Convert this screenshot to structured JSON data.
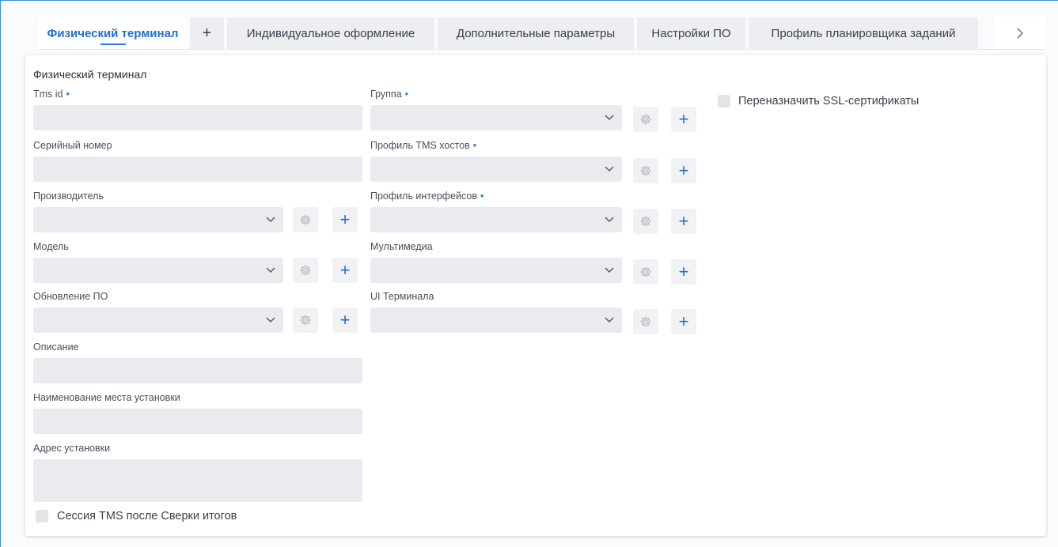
{
  "tabs": [
    {
      "label": "Физический терминал",
      "active": true
    },
    {
      "label": "+"
    },
    {
      "label": "Индивидуальное оформление"
    },
    {
      "label": "Дополнительные параметры"
    },
    {
      "label": "Настройки ПО"
    },
    {
      "label": "Профиль планировщика заданий"
    }
  ],
  "tab_scroll_icon": "chevron-right-icon",
  "card": {
    "title": "Физический терминал",
    "left": {
      "tms_id": {
        "label": "Tms id",
        "required_mark": "•",
        "value": ""
      },
      "serial": {
        "label": "Серийный номер",
        "value": ""
      },
      "manufacturer": {
        "label": "Производитель",
        "value": ""
      },
      "model": {
        "label": "Модель",
        "value": ""
      },
      "sw_update": {
        "label": "Обновление ПО",
        "value": ""
      },
      "description": {
        "label": "Описание",
        "value": ""
      },
      "install_place": {
        "label": "Наименование места установки",
        "value": ""
      },
      "install_address": {
        "label": "Адрес установки",
        "value": ""
      },
      "tms_session": {
        "label": "Сессия TMS после Сверки итогов",
        "checked": false
      }
    },
    "middle": {
      "group": {
        "label": "Группа",
        "required_mark": "•",
        "value": ""
      },
      "tms_hosts_profile": {
        "label": "Профиль TMS хостов",
        "required_mark": "•",
        "value": ""
      },
      "interfaces_profile": {
        "label": "Профиль интерфейсов",
        "required_mark": "•",
        "value": ""
      },
      "multimedia": {
        "label": "Мультимедиа",
        "value": ""
      },
      "ui_terminal": {
        "label": "UI Терминала",
        "value": ""
      }
    },
    "right": {
      "reassign_ssl": {
        "label": "Переназначить SSL-сертификаты",
        "checked": false
      }
    }
  },
  "colors": {
    "accent": "#1f6fd6",
    "field_bg": "#e9ebef",
    "frame_border": "#3b8fd9"
  }
}
